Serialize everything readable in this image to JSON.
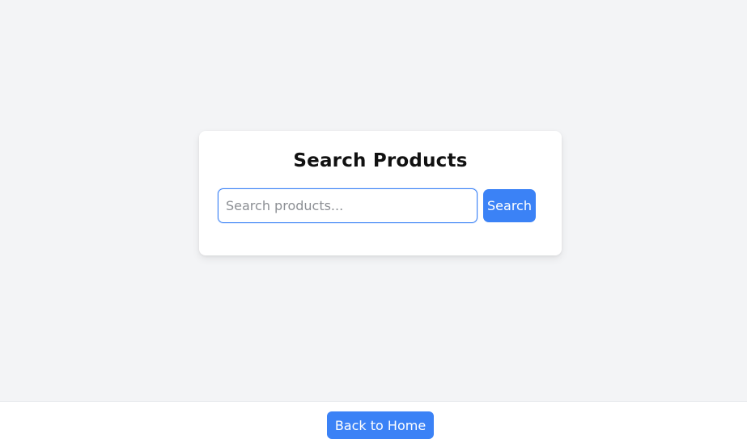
{
  "search_card": {
    "title": "Search Products",
    "input_value": "",
    "input_placeholder": "Search products...",
    "button_label": "Search"
  },
  "footer": {
    "home_label": "Back to Home"
  },
  "colors": {
    "accent": "#3b82f6",
    "page_background": "#f3f4f6",
    "card_background": "#ffffff"
  }
}
